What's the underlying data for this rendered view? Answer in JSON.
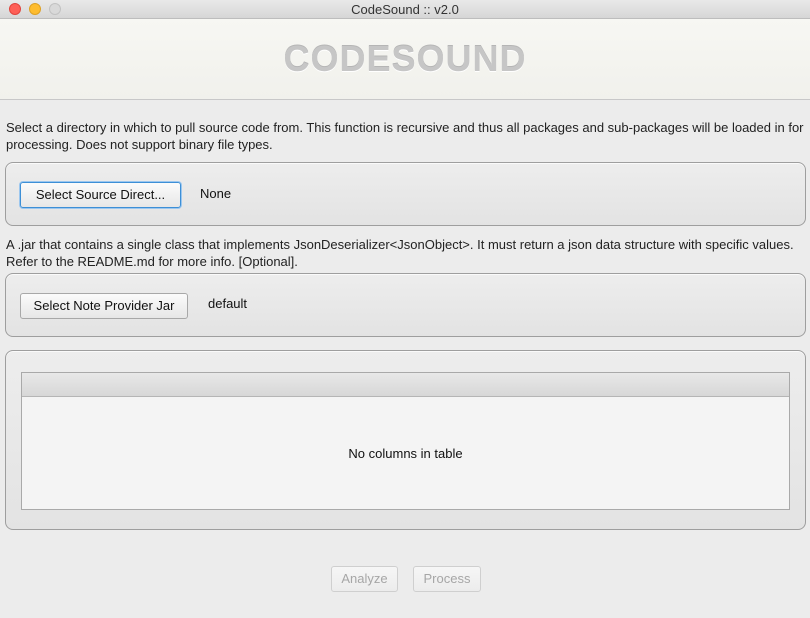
{
  "window": {
    "title": "CodeSound :: v2.0"
  },
  "header": {
    "logo_text": "CODESOUND"
  },
  "source_section": {
    "description": "Select a directory in which to pull source code from. This function is recursive and thus all packages and sub-packages will be loaded in for processing. Does not support binary file types.",
    "button_label": "Select Source Direct...",
    "value": "None"
  },
  "jar_section": {
    "description": "A .jar that contains a single class that implements JsonDeserializer<JsonObject>. It must return a json data structure with specific values. Refer to the README.md for more info. [Optional].",
    "button_label": "Select Note Provider Jar",
    "value": "default"
  },
  "table": {
    "empty_message": "No columns in table"
  },
  "actions": {
    "analyze_label": "Analyze",
    "process_label": "Process"
  },
  "colors": {
    "close": "#fe5f57",
    "minimize": "#febc2e",
    "focus_ring": "#3d8fd6"
  }
}
